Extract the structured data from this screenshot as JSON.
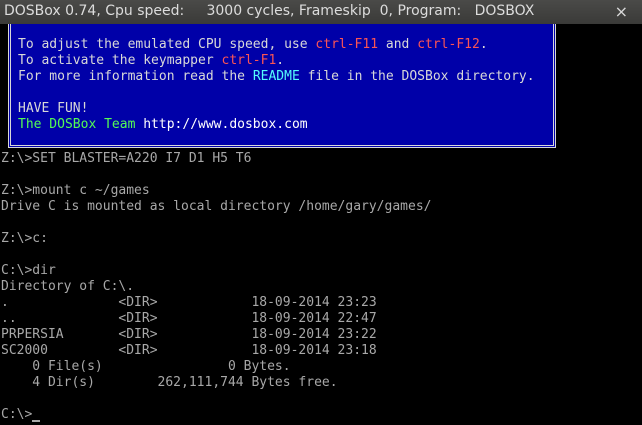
{
  "window": {
    "title": "DOSBox 0.74, Cpu speed:     3000 cycles, Frameskip  0, Program:   DOSBOX",
    "close_glyph": "×"
  },
  "banner": {
    "line1_pre": "To adjust the emulated CPU speed, use ",
    "line1_key1": "ctrl-F11",
    "line1_mid": " and ",
    "line1_key2": "ctrl-F12",
    "line1_post": ".",
    "line2_pre": "To activate the keymapper ",
    "line2_key": "ctrl-F1",
    "line2_post": ".",
    "line3_pre": "For more information read the ",
    "line3_readme": "README",
    "line3_post": " file in the DOSBox directory.",
    "fun": "HAVE FUN!",
    "team": "The DOSBox Team ",
    "url": "http://www.dosbox.com"
  },
  "terminal": {
    "lines": [
      "Z:\\>SET BLASTER=A220 I7 D1 H5 T6",
      "",
      "Z:\\>mount c ~/games",
      "Drive C is mounted as local directory /home/gary/games/",
      "",
      "Z:\\>c:",
      "",
      "C:\\>dir",
      "Directory of C:\\.",
      ".              <DIR>            18-09-2014 23:23",
      "..             <DIR>            18-09-2014 22:47",
      "PRPERSIA       <DIR>            18-09-2014 23:22",
      "SC2000         <DIR>            18-09-2014 23:18",
      "    0 File(s)                0 Bytes.",
      "    4 Dir(s)        262,111,744 Bytes free.",
      ""
    ],
    "prompt": "C:\\>"
  },
  "colors": {
    "banner_bg": "#0000a8",
    "text_gray": "#a8a8a8",
    "key_red": "#fc5454",
    "readme_cyan": "#54fcfc",
    "fun_green": "#54fc54"
  }
}
